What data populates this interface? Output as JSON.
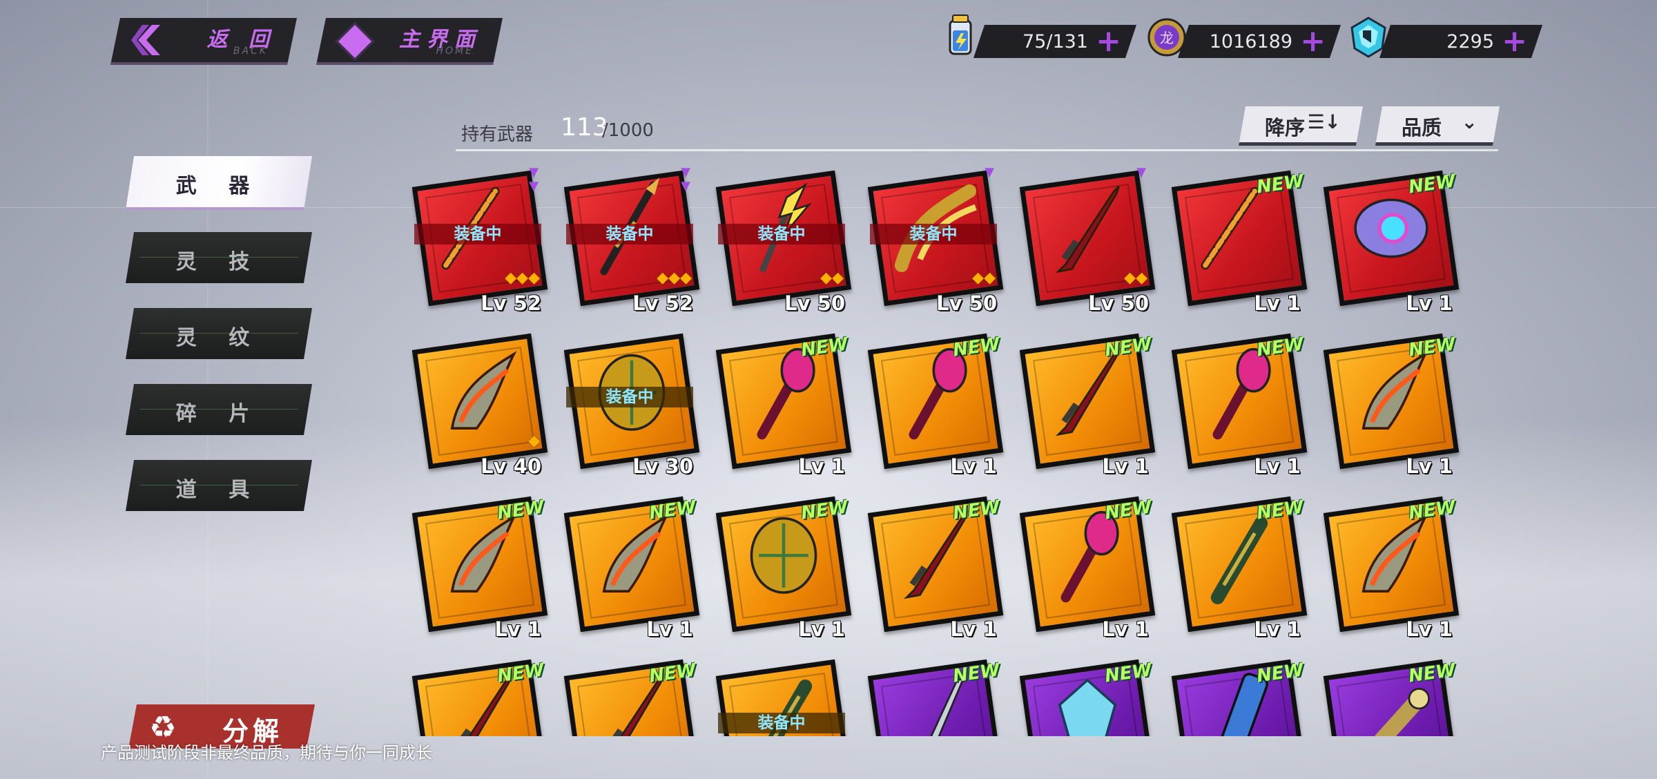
{
  "nav": {
    "back_label": "返 回",
    "back_sub": "BACK",
    "home_label": "主界面",
    "home_sub": "HOME"
  },
  "currencies": [
    {
      "name": "energy-icon",
      "value": "75/131"
    },
    {
      "name": "coin-icon",
      "value": "1016189"
    },
    {
      "name": "crystal-icon",
      "value": "2295"
    }
  ],
  "inventory": {
    "held_label": "持有武器",
    "held_count": "113",
    "held_max": "/1000"
  },
  "sort": {
    "order_label": "降序",
    "order_icon": "sort-descending-icon",
    "filter_label": "品质",
    "filter_icon": "chevron-down-icon"
  },
  "tabs": [
    {
      "label": "武 器",
      "active": true
    },
    {
      "label": "灵 技",
      "active": false
    },
    {
      "label": "灵 纹",
      "active": false
    },
    {
      "label": "碎 片",
      "active": false
    },
    {
      "label": "道 具",
      "active": false
    }
  ],
  "decompose": {
    "label": "分解",
    "icon": "recycle-icon"
  },
  "footer": "产品测试阶段非最终品质，期待与你一同成长",
  "badges": {
    "equipped": "装备中",
    "new": "NEW"
  },
  "weapons": [
    {
      "rarity": "red",
      "weapon": "chain-whip",
      "level": "Lv 52",
      "equipped": true,
      "stars": "◆◆◆",
      "rank": "▼▼"
    },
    {
      "rarity": "red",
      "weapon": "spear",
      "level": "Lv 52",
      "equipped": true,
      "stars": "◆◆◆",
      "rank": "▼▼"
    },
    {
      "rarity": "red",
      "weapon": "lightning-staff",
      "level": "Lv 50",
      "equipped": true,
      "stars": "◆◆",
      "rank": ""
    },
    {
      "rarity": "red",
      "weapon": "golden-claw",
      "level": "Lv 50",
      "equipped": true,
      "stars": "◆◆",
      "rank": "▼"
    },
    {
      "rarity": "red",
      "weapon": "crimson-blade",
      "level": "Lv 50",
      "equipped": false,
      "stars": "◆◆",
      "rank": "▼"
    },
    {
      "rarity": "red",
      "weapon": "chain-whip",
      "level": "Lv 1",
      "equipped": false,
      "new": true
    },
    {
      "rarity": "red",
      "weapon": "orb-gauntlet",
      "level": "Lv 1",
      "equipped": false,
      "new": true
    },
    {
      "rarity": "orange",
      "weapon": "flame-claw",
      "level": "Lv 40",
      "equipped": false,
      "stars": "◆"
    },
    {
      "rarity": "orange",
      "weapon": "golden-orb",
      "level": "Lv 30",
      "equipped": true
    },
    {
      "rarity": "orange",
      "weapon": "pink-torch",
      "level": "Lv 1",
      "new": true
    },
    {
      "rarity": "orange",
      "weapon": "pink-torch",
      "level": "Lv 1",
      "new": true
    },
    {
      "rarity": "orange",
      "weapon": "crimson-blade",
      "level": "Lv 1",
      "new": true
    },
    {
      "rarity": "orange",
      "weapon": "pink-torch",
      "level": "Lv 1",
      "new": true
    },
    {
      "rarity": "orange",
      "weapon": "flame-claw",
      "level": "Lv 1",
      "new": true
    },
    {
      "rarity": "orange",
      "weapon": "flame-claw",
      "level": "Lv 1",
      "new": true
    },
    {
      "rarity": "orange",
      "weapon": "flame-claw",
      "level": "Lv 1",
      "new": true
    },
    {
      "rarity": "orange",
      "weapon": "golden-orb",
      "level": "Lv 1",
      "new": true
    },
    {
      "rarity": "orange",
      "weapon": "crimson-blade",
      "level": "Lv 1",
      "new": true
    },
    {
      "rarity": "orange",
      "weapon": "pink-torch",
      "level": "Lv 1",
      "new": true
    },
    {
      "rarity": "orange",
      "weapon": "green-cannon",
      "level": "Lv 1",
      "new": true
    },
    {
      "rarity": "orange",
      "weapon": "flame-claw",
      "level": "Lv 1",
      "new": true
    },
    {
      "rarity": "orange",
      "weapon": "crimson-blade",
      "level": "",
      "new": true
    },
    {
      "rarity": "orange",
      "weapon": "crimson-blade",
      "level": "",
      "new": true
    },
    {
      "rarity": "orange",
      "weapon": "green-cannon",
      "level": "",
      "equipped": true
    },
    {
      "rarity": "purple",
      "weapon": "silver-spear",
      "level": "",
      "new": true
    },
    {
      "rarity": "purple",
      "weapon": "ice-crystal",
      "level": "",
      "new": true
    },
    {
      "rarity": "purple",
      "weapon": "blue-cylinder",
      "level": "",
      "new": true
    },
    {
      "rarity": "purple",
      "weapon": "gold-cannon",
      "level": "",
      "new": true
    }
  ],
  "colors": {
    "accent": "#c86cf0",
    "new_badge": "#b8ff62",
    "equipped_text": "#8fe6ff",
    "decompose": "#a8312e"
  }
}
